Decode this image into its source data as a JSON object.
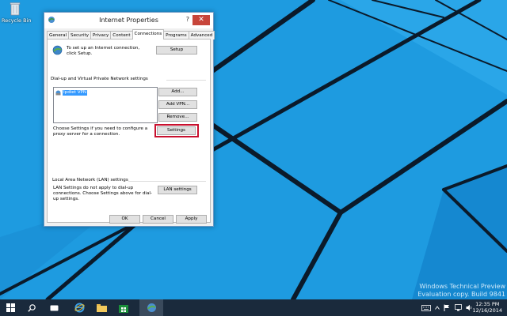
{
  "desktop": {
    "recycle_bin_label": "Recycle Bin",
    "watermark_line1": "Windows Technical Preview",
    "watermark_line2": "Evaluation copy. Build 9841"
  },
  "dialog": {
    "title": "Internet Properties",
    "help_glyph": "?",
    "close_glyph": "✕",
    "tabs": [
      "General",
      "Security",
      "Privacy",
      "Content",
      "Connections",
      "Programs",
      "Advanced"
    ],
    "active_tab": "Connections",
    "setup_text": "To set up an Internet connection, click Setup.",
    "setup_button": "Setup",
    "dialup_header": "Dial-up and Virtual Private Network settings",
    "connection_item": "Ipdiet VPN",
    "add_button": "Add...",
    "add_vpn_button": "Add VPN...",
    "remove_button": "Remove...",
    "settings_text": "Choose Settings if you need to configure a proxy server for a connection.",
    "settings_button": "Settings",
    "lan_header": "Local Area Network (LAN) settings",
    "lan_text": "LAN Settings do not apply to dial-up connections. Choose Settings above for dial-up settings.",
    "lan_button": "LAN settings",
    "ok_button": "OK",
    "cancel_button": "Cancel",
    "apply_button": "Apply"
  },
  "taskbar": {
    "time": "12:35 PM",
    "date": "12/16/2014"
  },
  "colors": {
    "desktop_blue": "#1e9be0",
    "highlight_red": "#c8102e",
    "taskbar": "#1a2a3c"
  }
}
